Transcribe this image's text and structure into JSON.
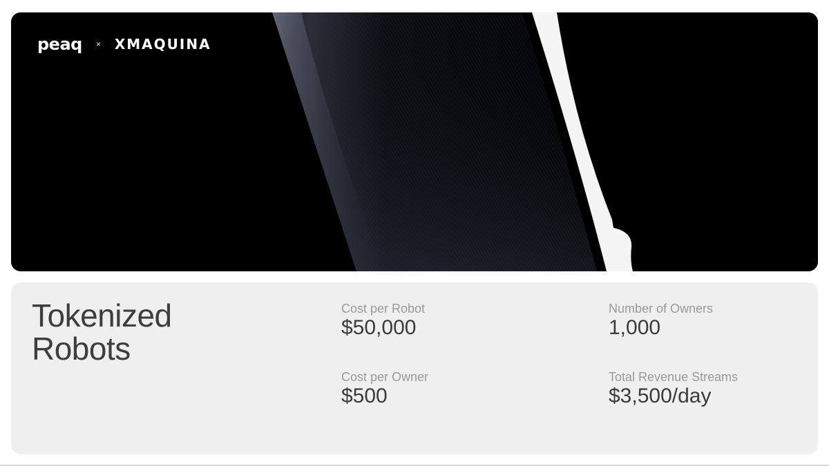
{
  "hero": {
    "brand_left": "peaq",
    "brand_separator": "×",
    "brand_right": "XMAQUINA",
    "image": "robot-closeup"
  },
  "card": {
    "title_line1": "Tokenized",
    "title_line2": "Robots",
    "stats": [
      {
        "label": "Cost per Robot",
        "value": "$50,000"
      },
      {
        "label": "Number of Owners",
        "value": "1,000"
      },
      {
        "label": "Cost per Owner",
        "value": "$500"
      },
      {
        "label": "Total Revenue Streams",
        "value": "$3,500/day"
      }
    ]
  },
  "colors": {
    "hero_background": "#000000",
    "card_background": "#efefef",
    "label_text": "#9a9a9a",
    "value_text": "#3b3b3b"
  }
}
